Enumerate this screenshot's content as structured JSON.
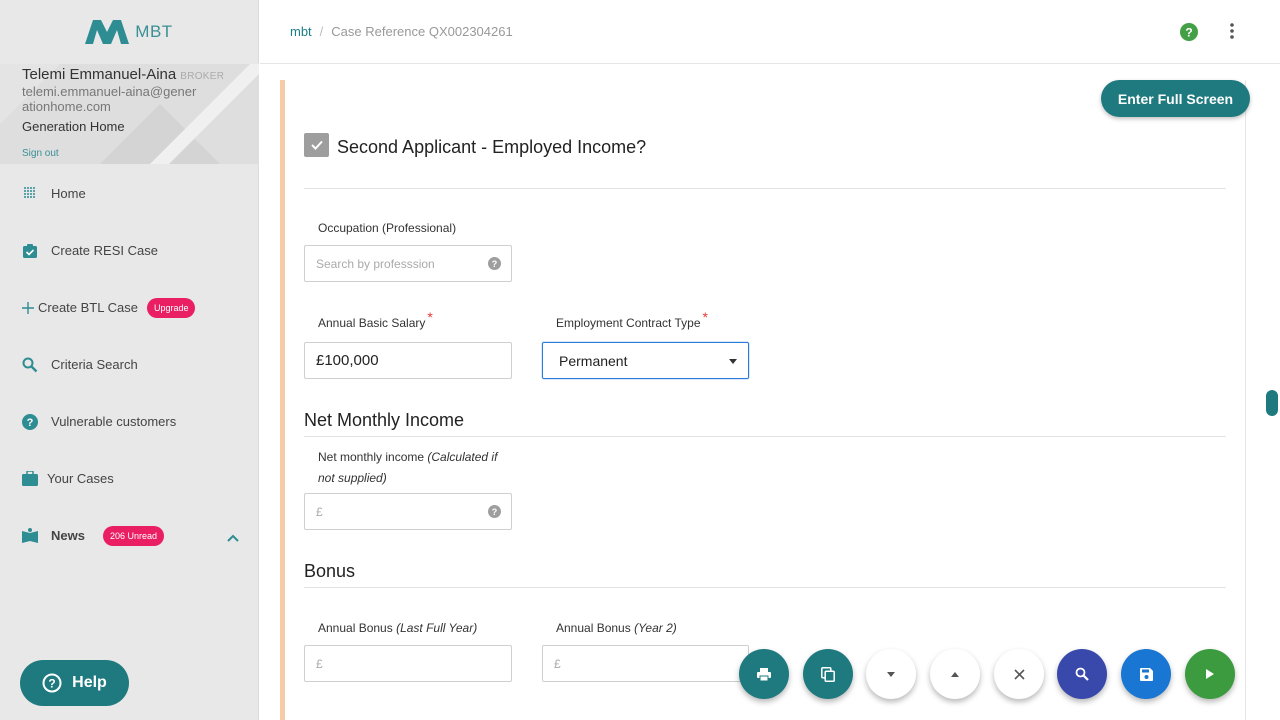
{
  "brand": {
    "name": "MBT",
    "color": "#3b8f95"
  },
  "profile": {
    "name": "Telemi Emmanuel-Aina",
    "role": "BROKER",
    "email": "telemi.emmanuel-aina@generationhome.com",
    "company": "Generation Home",
    "sign_out": "Sign out"
  },
  "sidebar": {
    "items": [
      {
        "label": "Home",
        "icon": "grid-icon"
      },
      {
        "label": "Create RESI Case",
        "icon": "clipboard-check-icon"
      },
      {
        "label": "Create BTL Case",
        "icon": "plus-icon",
        "badge": "Upgrade"
      },
      {
        "label": "Criteria Search",
        "icon": "search-icon"
      },
      {
        "label": "Vulnerable customers",
        "icon": "help-circle-icon"
      },
      {
        "label": "Your Cases",
        "icon": "briefcase-icon"
      },
      {
        "label": "News",
        "icon": "book-icon",
        "badge": "206 Unread"
      }
    ],
    "help_label": "Help"
  },
  "header": {
    "breadcrumb_home": "mbt",
    "breadcrumb_separator": "/",
    "breadcrumb_current": "Case Reference QX002304261"
  },
  "form": {
    "fullscreen_label": "Enter Full Screen",
    "checkbox_title": "Second Applicant - Employed Income?",
    "checkbox_checked": true,
    "occupation": {
      "label": "Occupation (Professional)",
      "placeholder": "Search by professsion"
    },
    "salary": {
      "label": "Annual Basic Salary",
      "required": "*",
      "value": "£100,000"
    },
    "contract": {
      "label": "Employment Contract Type",
      "required": "*",
      "value": "Permanent"
    },
    "net_monthly": {
      "section": "Net Monthly Income",
      "label": "Net monthly income",
      "label_note": "(Calculated if not supplied)",
      "placeholder": "£"
    },
    "bonus": {
      "section": "Bonus",
      "last_label": "Annual Bonus",
      "last_note": "(Last Full Year)",
      "last_placeholder": "£",
      "y2_label": "Annual Bonus",
      "y2_note": "(Year 2)",
      "y2_placeholder": "£"
    }
  },
  "toolbar": {
    "buttons": [
      "print-icon",
      "copy-icon",
      "chevron-down-icon",
      "chevron-up-icon",
      "close-icon",
      "search-icon",
      "save-icon",
      "play-icon"
    ]
  },
  "colors": {
    "teal": "#1f7a7f",
    "pink": "#e91e63",
    "accent_border": "#f8cba8",
    "required": "#e53935"
  }
}
